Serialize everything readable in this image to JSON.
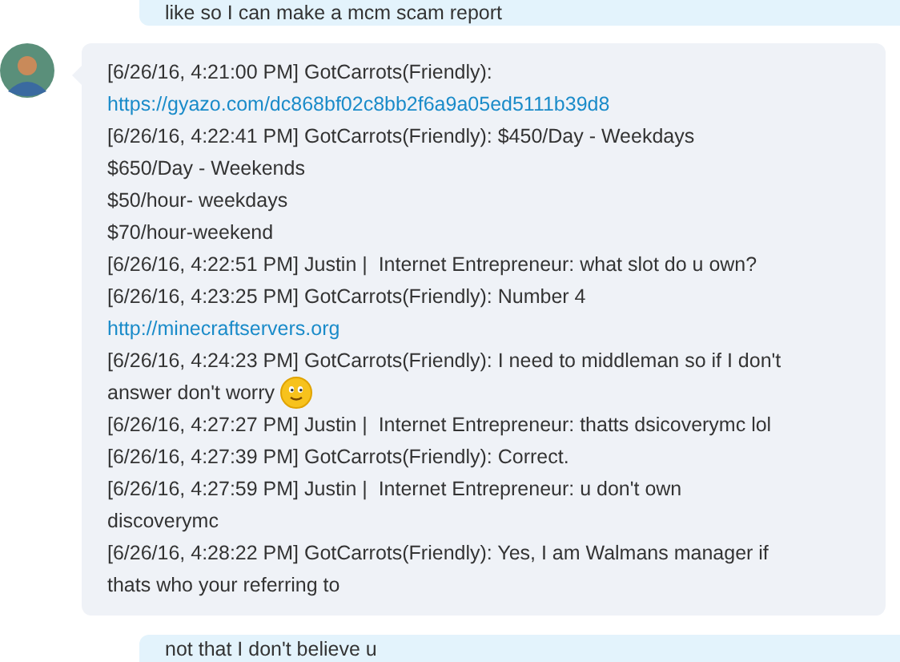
{
  "top_message": {
    "text": "like so I can make a mcm scam report"
  },
  "incoming": {
    "lines": [
      {
        "kind": "text",
        "text": "[6/26/16, 4:21:00 PM] GotCarrots(Friendly):",
        "emoji": false
      },
      {
        "kind": "link",
        "text": "https://gyazo.com/dc868bf02c8bb2f6a9a05ed5111b39d8",
        "emoji": false
      },
      {
        "kind": "text",
        "text": "[6/26/16, 4:22:41 PM] GotCarrots(Friendly): $450/Day - Weekdays",
        "emoji": false
      },
      {
        "kind": "text",
        "text": "$650/Day - Weekends",
        "emoji": false
      },
      {
        "kind": "text",
        "text": "$50/hour- weekdays",
        "emoji": false
      },
      {
        "kind": "text",
        "text": "$70/hour-weekend",
        "emoji": false
      },
      {
        "kind": "text",
        "text": "[6/26/16, 4:22:51 PM] Justin |  Internet Entrepreneur: what slot do u own?",
        "emoji": false
      },
      {
        "kind": "text",
        "text": "[6/26/16, 4:23:25 PM] GotCarrots(Friendly): Number 4",
        "emoji": false
      },
      {
        "kind": "link",
        "text": "http://minecraftservers.org",
        "emoji": false
      },
      {
        "kind": "text",
        "text": "[6/26/16, 4:24:23 PM] GotCarrots(Friendly): I need to middleman so if I don't",
        "emoji": false
      },
      {
        "kind": "text",
        "text": "answer don't worry",
        "emoji": true
      },
      {
        "kind": "text",
        "text": "[6/26/16, 4:27:27 PM] Justin |  Internet Entrepreneur: thatts dsicoverymc lol",
        "emoji": false
      },
      {
        "kind": "text",
        "text": "[6/26/16, 4:27:39 PM] GotCarrots(Friendly): Correct.",
        "emoji": false
      },
      {
        "kind": "text",
        "text": "[6/26/16, 4:27:59 PM] Justin |  Internet Entrepreneur: u don't own",
        "emoji": false
      },
      {
        "kind": "text",
        "text": "discoverymc",
        "emoji": false
      },
      {
        "kind": "text",
        "text": "[6/26/16, 4:28:22 PM] GotCarrots(Friendly): Yes, I am Walmans manager if",
        "emoji": false
      },
      {
        "kind": "text",
        "text": "thats who your referring to",
        "emoji": false
      }
    ]
  },
  "bottom_message": {
    "text": "not that I don't believe u"
  }
}
